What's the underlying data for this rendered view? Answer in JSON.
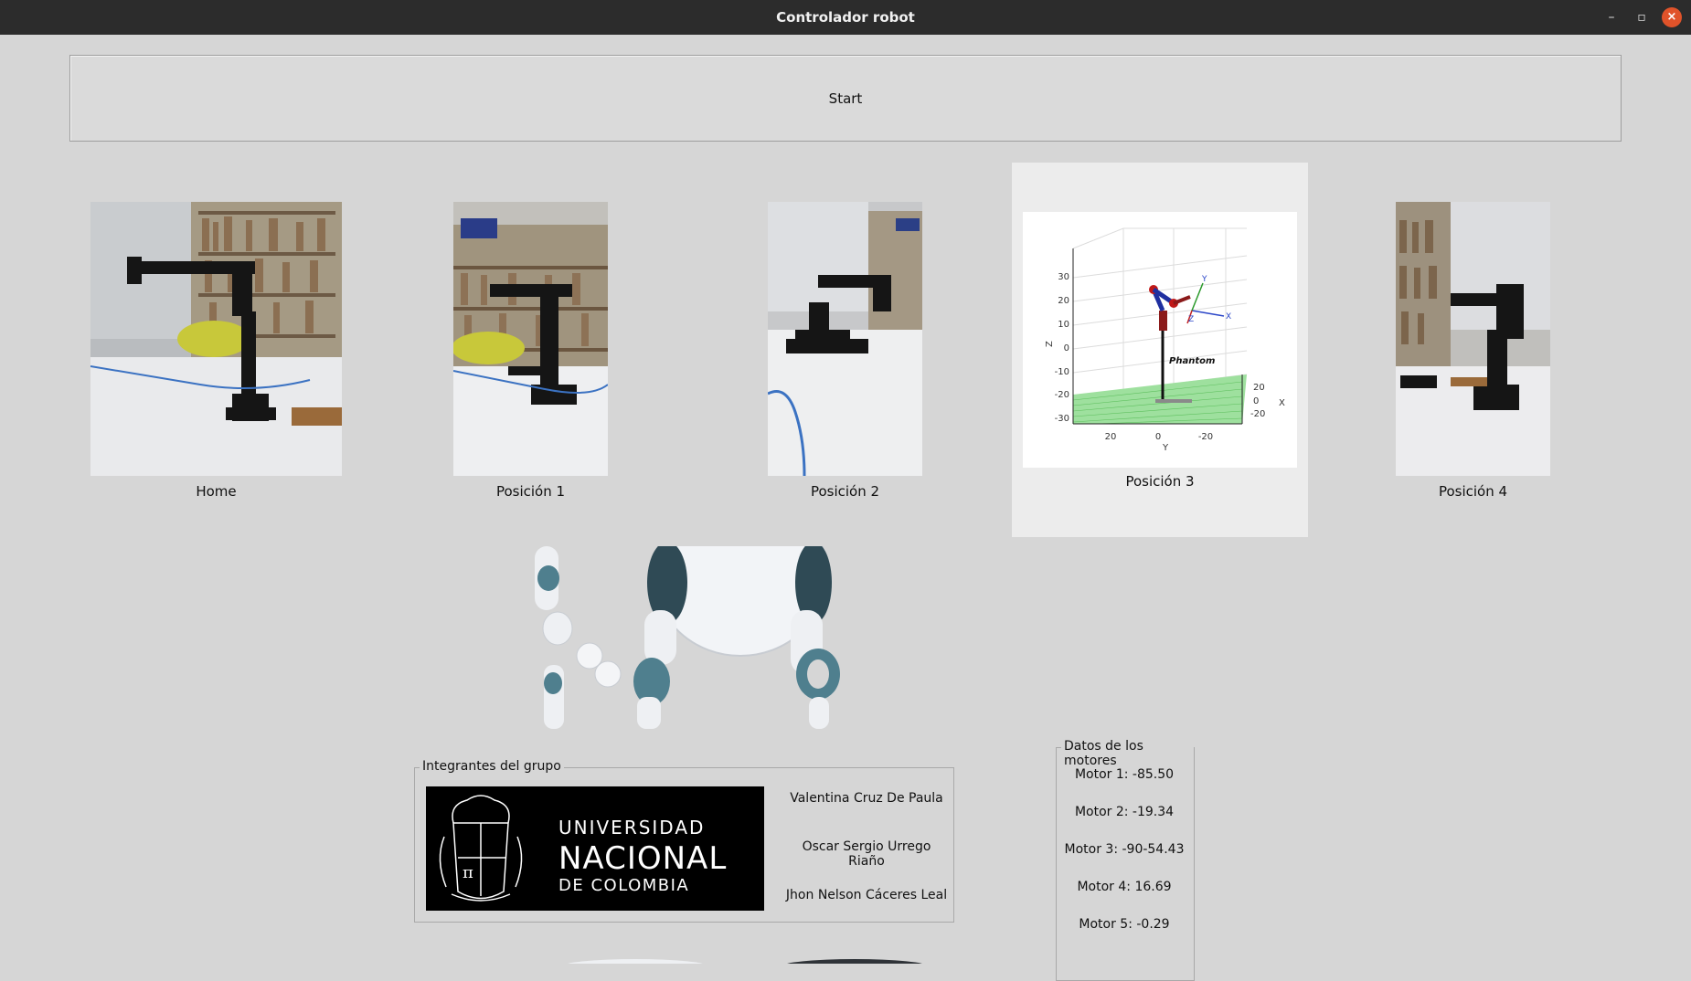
{
  "window": {
    "title": "Controlador robot"
  },
  "start_button": {
    "label": "Start"
  },
  "positions": [
    {
      "label": "Home"
    },
    {
      "label": "Posición 1"
    },
    {
      "label": "Posición 2"
    },
    {
      "label": "Posición 3"
    },
    {
      "label": "Posición 4"
    }
  ],
  "plot": {
    "label_z": "Z",
    "label_y": "Y",
    "label_x": "X",
    "phantom": "Phantom",
    "z_ticks": [
      "30",
      "20",
      "10",
      "0",
      "-10",
      "-20",
      "-30"
    ],
    "y_ticks": [
      "20",
      "0",
      "-20"
    ],
    "x_ticks": [
      "20",
      "0",
      "-20"
    ],
    "frame_y": "Y",
    "frame_z": "Z",
    "frame_x": "X"
  },
  "group": {
    "title": "Integrantes del grupo",
    "logo": {
      "line1": "UNIVERSIDAD",
      "line2": "NACIONAL",
      "line3": "DE COLOMBIA"
    },
    "members": [
      "Valentina Cruz De Paula",
      "Oscar Sergio Urrego Riaño",
      "Jhon Nelson Cáceres Leal"
    ]
  },
  "motors": {
    "title": "Datos de los motores",
    "items": [
      "Motor 1: -85.50",
      "Motor 2: -19.34",
      "Motor 3: -90-54.43",
      "Motor 4: 16.69",
      "Motor 5: -0.29"
    ]
  }
}
